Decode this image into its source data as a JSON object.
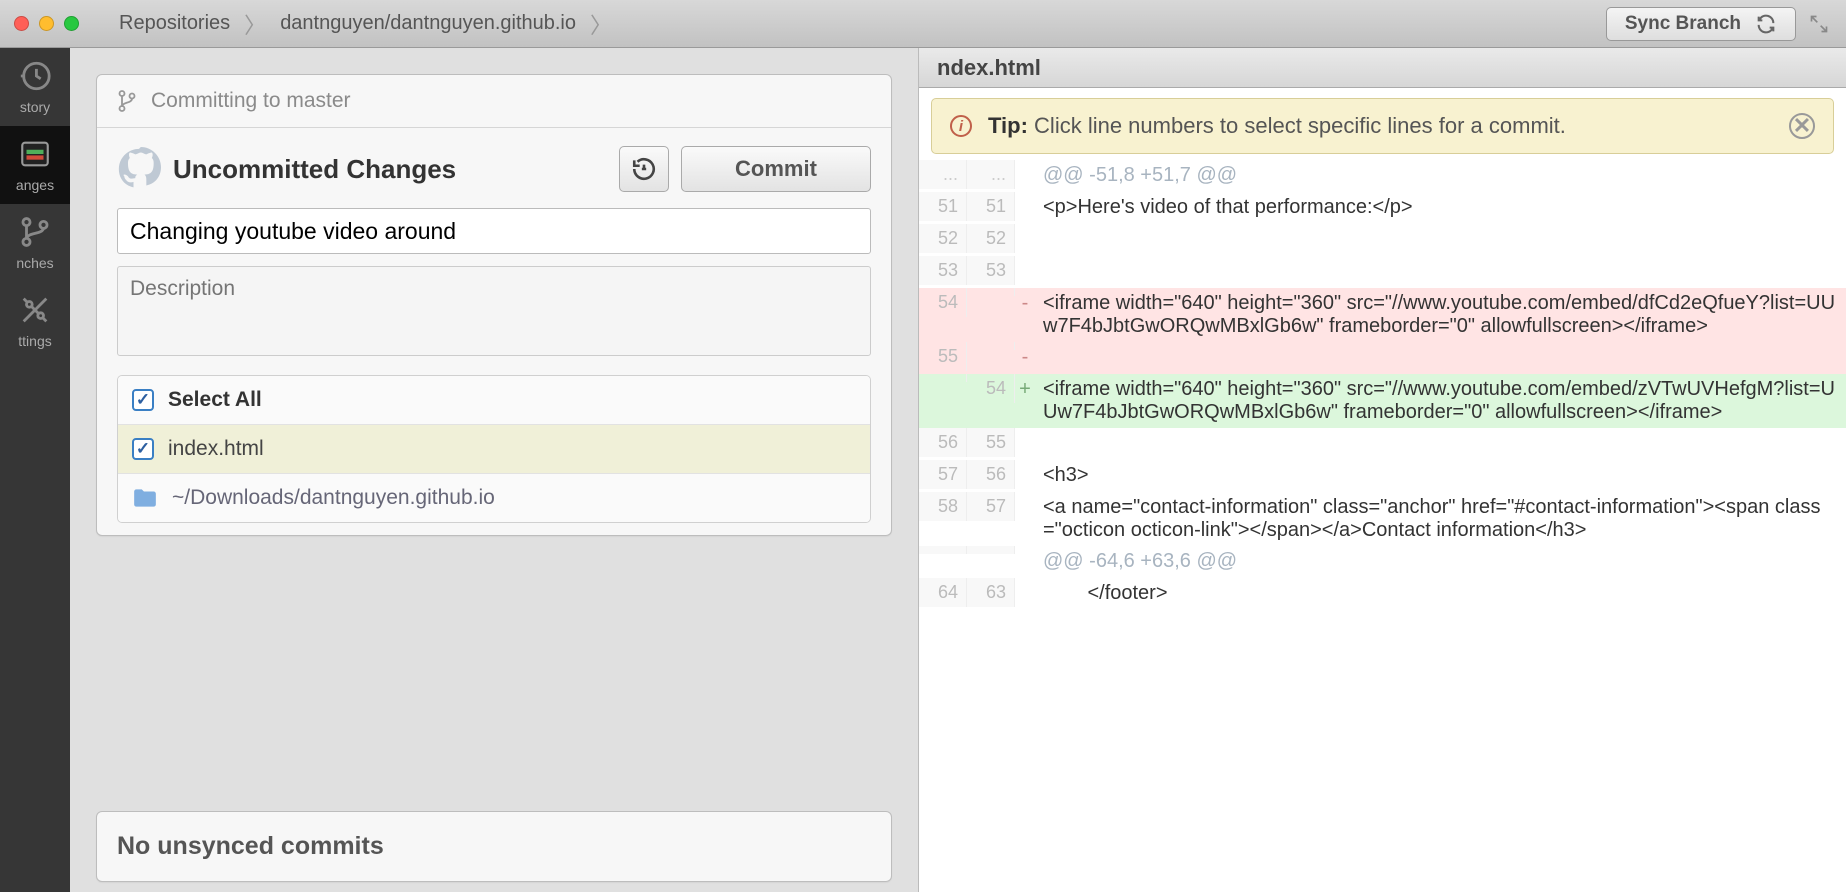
{
  "titlebar": {
    "breadcrumbs": [
      "Repositories",
      "dantnguyen/dantnguyen.github.io"
    ],
    "sync_label": "Sync Branch"
  },
  "sidebar": {
    "items": [
      {
        "label": "story",
        "icon": "history"
      },
      {
        "label": "anges",
        "icon": "changes"
      },
      {
        "label": "nches",
        "icon": "branches"
      },
      {
        "label": "ttings",
        "icon": "settings"
      }
    ]
  },
  "commit_panel": {
    "branch_text": "Committing to master",
    "uncommitted_title": "Uncommitted Changes",
    "commit_label": "Commit",
    "summary_value": "Changing youtube video around",
    "description_placeholder": "Description",
    "select_all": "Select All",
    "file": "index.html",
    "repo_path": "~/Downloads/dantnguyen.github.io",
    "unsynced_text": "No unsynced commits"
  },
  "diff": {
    "filename": "ndex.html",
    "tip_bold": "Tip:",
    "tip_text": "Click line numbers to select specific lines for a commit.",
    "lines": [
      {
        "old": "...",
        "new": "...",
        "sign": "",
        "type": "hunk",
        "text": "@@ -51,8 +51,7 @@"
      },
      {
        "old": "51",
        "new": "51",
        "sign": "",
        "type": "ctx",
        "text": "<p>Here's video of that performance:</p>"
      },
      {
        "old": "52",
        "new": "52",
        "sign": "",
        "type": "ctx",
        "text": ""
      },
      {
        "old": "53",
        "new": "53",
        "sign": "",
        "type": "ctx",
        "text": ""
      },
      {
        "old": "54",
        "new": "",
        "sign": "-",
        "type": "minus",
        "text": "<iframe width=\"640\" height=\"360\" src=\"//www.youtube.com/embed/dfCd2eQfueY?list=UUw7F4bJbtGwORQwMBxlGb6w\" frameborder=\"0\" allowfullscreen></iframe>"
      },
      {
        "old": "55",
        "new": "",
        "sign": "-",
        "type": "minus",
        "text": ""
      },
      {
        "old": "",
        "new": "54",
        "sign": "+",
        "type": "plus",
        "text": "<iframe width=\"640\" height=\"360\" src=\"//www.youtube.com/embed/zVTwUVHefgM?list=UUw7F4bJbtGwORQwMBxlGb6w\" frameborder=\"0\" allowfullscreen></iframe>"
      },
      {
        "old": "56",
        "new": "55",
        "sign": "",
        "type": "ctx",
        "text": ""
      },
      {
        "old": "57",
        "new": "56",
        "sign": "",
        "type": "ctx",
        "text": "<h3>"
      },
      {
        "old": "58",
        "new": "57",
        "sign": "",
        "type": "ctx",
        "text": "<a name=\"contact-information\" class=\"anchor\" href=\"#contact-information\"><span class=\"octicon octicon-link\"></span></a>Contact information</h3>"
      },
      {
        "old": "",
        "new": "",
        "sign": "",
        "type": "hunk",
        "text": "@@ -64,6 +63,6 @@"
      },
      {
        "old": "64",
        "new": "63",
        "sign": "",
        "type": "ctx",
        "text": "        </footer>"
      }
    ]
  }
}
